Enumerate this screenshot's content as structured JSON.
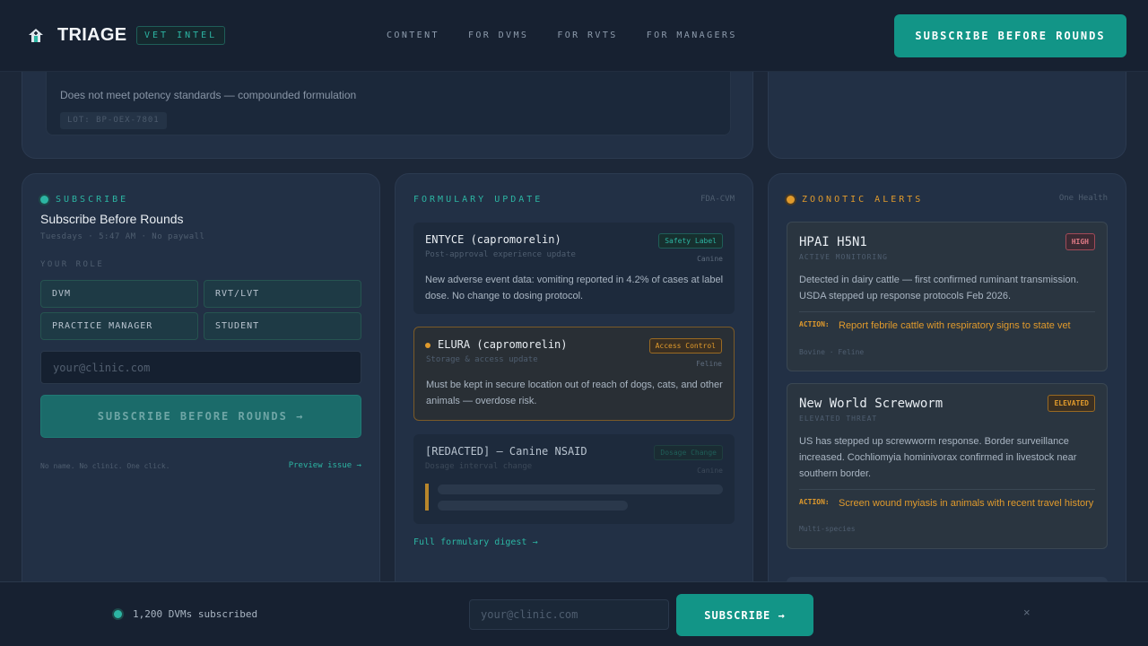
{
  "header": {
    "brand": "TRIAGE",
    "badge": "VET INTEL",
    "nav": [
      "CONTENT",
      "FOR DVMS",
      "FOR RVTS",
      "FOR MANAGERS"
    ],
    "cta": "SUBSCRIBE BEFORE ROUNDS"
  },
  "top_card": {
    "message": "Does not meet potency standards — compounded formulation",
    "lot": "LOT: BP-OEX-7801"
  },
  "subscribe": {
    "label": "SUBSCRIBE",
    "title": "Subscribe Before Rounds",
    "meta": "Tuesdays · 5:47 AM · No paywall",
    "role_label": "YOUR ROLE",
    "roles": [
      "DVM",
      "RVT/LVT",
      "PRACTICE MANAGER",
      "STUDENT"
    ],
    "email_placeholder": "your@clinic.com",
    "button": "SUBSCRIBE BEFORE ROUNDS →",
    "footnote": "No name. No clinic. One click.",
    "preview_link": "Preview issue →"
  },
  "formulary": {
    "label": "FORMULARY UPDATE",
    "source": "FDA-CVM",
    "items": [
      {
        "name": "ENTYCE (capromorelin)",
        "sub": "Post-approval experience update",
        "chip": "Safety Label",
        "species": "Canine",
        "body": "New adverse event data: vomiting reported in 4.2% of cases at label dose. No change to dosing protocol."
      },
      {
        "name": "ELURA (capromorelin)",
        "sub": "Storage & access update",
        "chip": "Access Control",
        "species": "Feline",
        "body": "Must be kept in secure location out of reach of dogs, cats, and other animals — overdose risk."
      },
      {
        "name": "[REDACTED] — Canine NSAID",
        "sub": "Dosage interval change",
        "chip": "Dosage Change",
        "species": "Canine"
      }
    ],
    "digest_link": "Full formulary digest →"
  },
  "zoonotic": {
    "label": "ZOONOTIC ALERTS",
    "source": "One Health",
    "alerts": [
      {
        "name": "HPAI H5N1",
        "sub": "ACTIVE MONITORING",
        "level": "HIGH",
        "body": "Detected in dairy cattle — first confirmed ruminant transmission. USDA stepped up response protocols Feb 2026.",
        "action_label": "ACTION:",
        "action": "Report febrile cattle with respiratory signs to state vet",
        "foot": "Bovine · Feline"
      },
      {
        "name": "New World Screwworm",
        "sub": "ELEVATED THREAT",
        "level": "ELEVATED",
        "body": "US has stepped up screwworm response. Border surveillance increased. Cochliomyia hominivorax confirmed in livestock near southern border.",
        "action_label": "ACTION:",
        "action": "Screen wound myiasis in animals with recent travel history",
        "foot": "Multi-species"
      }
    ]
  },
  "bottom_bar": {
    "count": "1,200 DVMs subscribed",
    "email_placeholder": "your@clinic.com",
    "button": "SUBSCRIBE →",
    "close": "×"
  },
  "colors": {
    "accent": "#129587",
    "teal_text": "#2cb5a3",
    "amber": "#e09a2c",
    "danger": "#e07a86",
    "background": "#1c2738"
  }
}
